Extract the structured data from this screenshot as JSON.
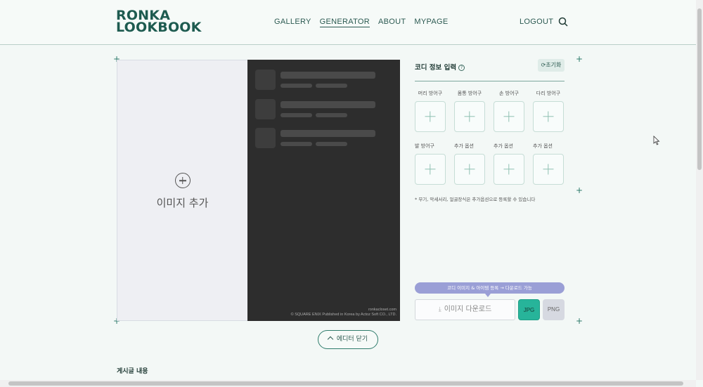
{
  "header": {
    "logo_line1": "RONKA",
    "logo_line2": "LOOKBOOK",
    "nav": [
      "GALLERY",
      "GENERATOR",
      "ABOUT",
      "MYPAGE"
    ],
    "active_nav": "GENERATOR",
    "logout": "LOGOUT",
    "search_icon": "search-icon"
  },
  "canvas": {
    "add_image_label": "이미지 추가",
    "credit_line1": "ronkacloset.com",
    "credit_line2": "© SQUARE ENIX Published in Korea by Actoz Soft CO., LTD."
  },
  "info": {
    "title": "코디 정보 입력",
    "help": "?",
    "reset_label": "초기화",
    "slots_row1": [
      "머리 방어구",
      "몸통 방어구",
      "손 방어구",
      "다리 방어구"
    ],
    "slots_row2": [
      "발 방어구",
      "추가 옵션",
      "추가 옵션",
      "추가 옵션"
    ],
    "note": "* 무기, 악세서리, 얼굴장식은 추가옵션으로 등록할 수 있습니다",
    "tip": "코디 이미지 & 아이템 등록 → 다운로드 가능",
    "download_label": "이미지 다운로드",
    "formats": [
      "JPG",
      "PNG"
    ],
    "selected_format": "JPG"
  },
  "close_editor_label": "에디터 닫기",
  "post_heading": "게시글 내용",
  "colors": {
    "brand": "#1e5b50",
    "accent": "#27b49a",
    "tip_bg": "#9a9fd6",
    "dark_panel": "#2d2d2d"
  }
}
